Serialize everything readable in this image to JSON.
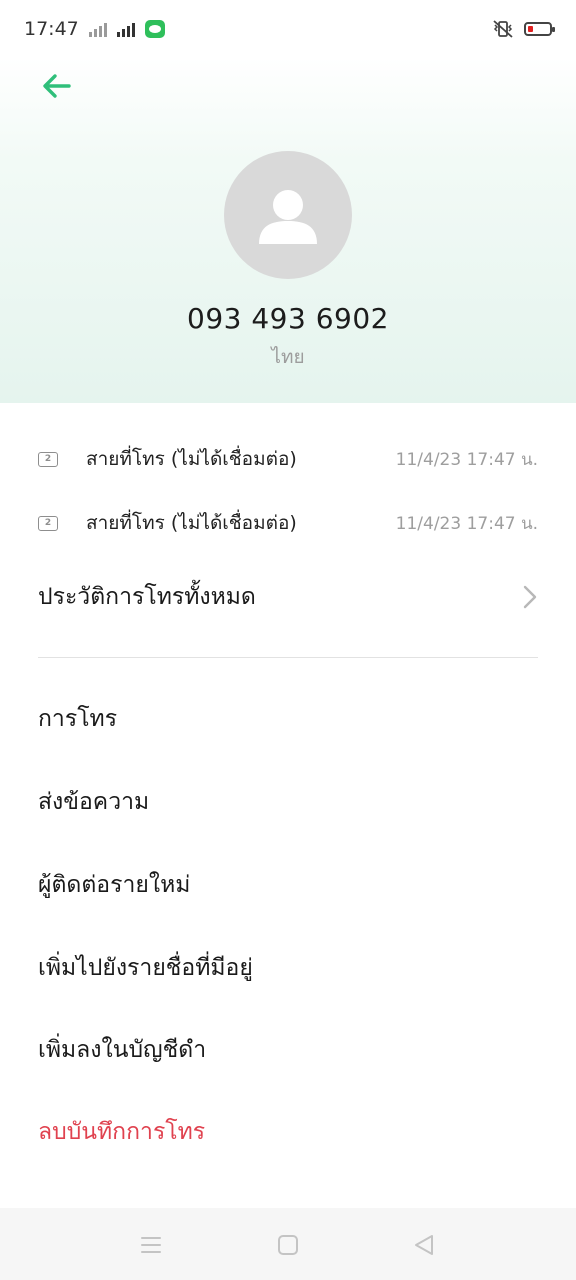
{
  "status_bar": {
    "time": "17:47",
    "icons": [
      "signal-x-icon",
      "signal-h-icon",
      "line-app-icon",
      "vibrate-icon",
      "battery-low-icon"
    ],
    "battery_color": "#e02020"
  },
  "header": {
    "back_icon": "back-arrow-icon",
    "accent": "#2fbf7a",
    "phone_number": "093 493 6902",
    "country": "ไทย"
  },
  "call_log": [
    {
      "sim": "2",
      "type": "สายที่โทร (ไม่ได้เชื่อมต่อ)",
      "time": "11/4/23 17:47 น."
    },
    {
      "sim": "2",
      "type": "สายที่โทร (ไม่ได้เชื่อมต่อ)",
      "time": "11/4/23 17:47 น."
    }
  ],
  "history": {
    "label": "ประวัติการโทรทั้งหมด",
    "icon": "chevron-right-icon"
  },
  "actions": {
    "call": "การโทร",
    "message": "ส่งข้อความ",
    "new_contact": "ผู้ติดต่อรายใหม่",
    "add_existing": "เพิ่มไปยังรายชื่อที่มีอยู่",
    "blacklist": "เพิ่มลงในบัญชีดำ",
    "delete_log": "ลบบันทึกการโทร",
    "delete_color": "#e0424f"
  },
  "nav_bar": {
    "icons": [
      "menu-icon",
      "home-icon",
      "back-icon"
    ]
  }
}
